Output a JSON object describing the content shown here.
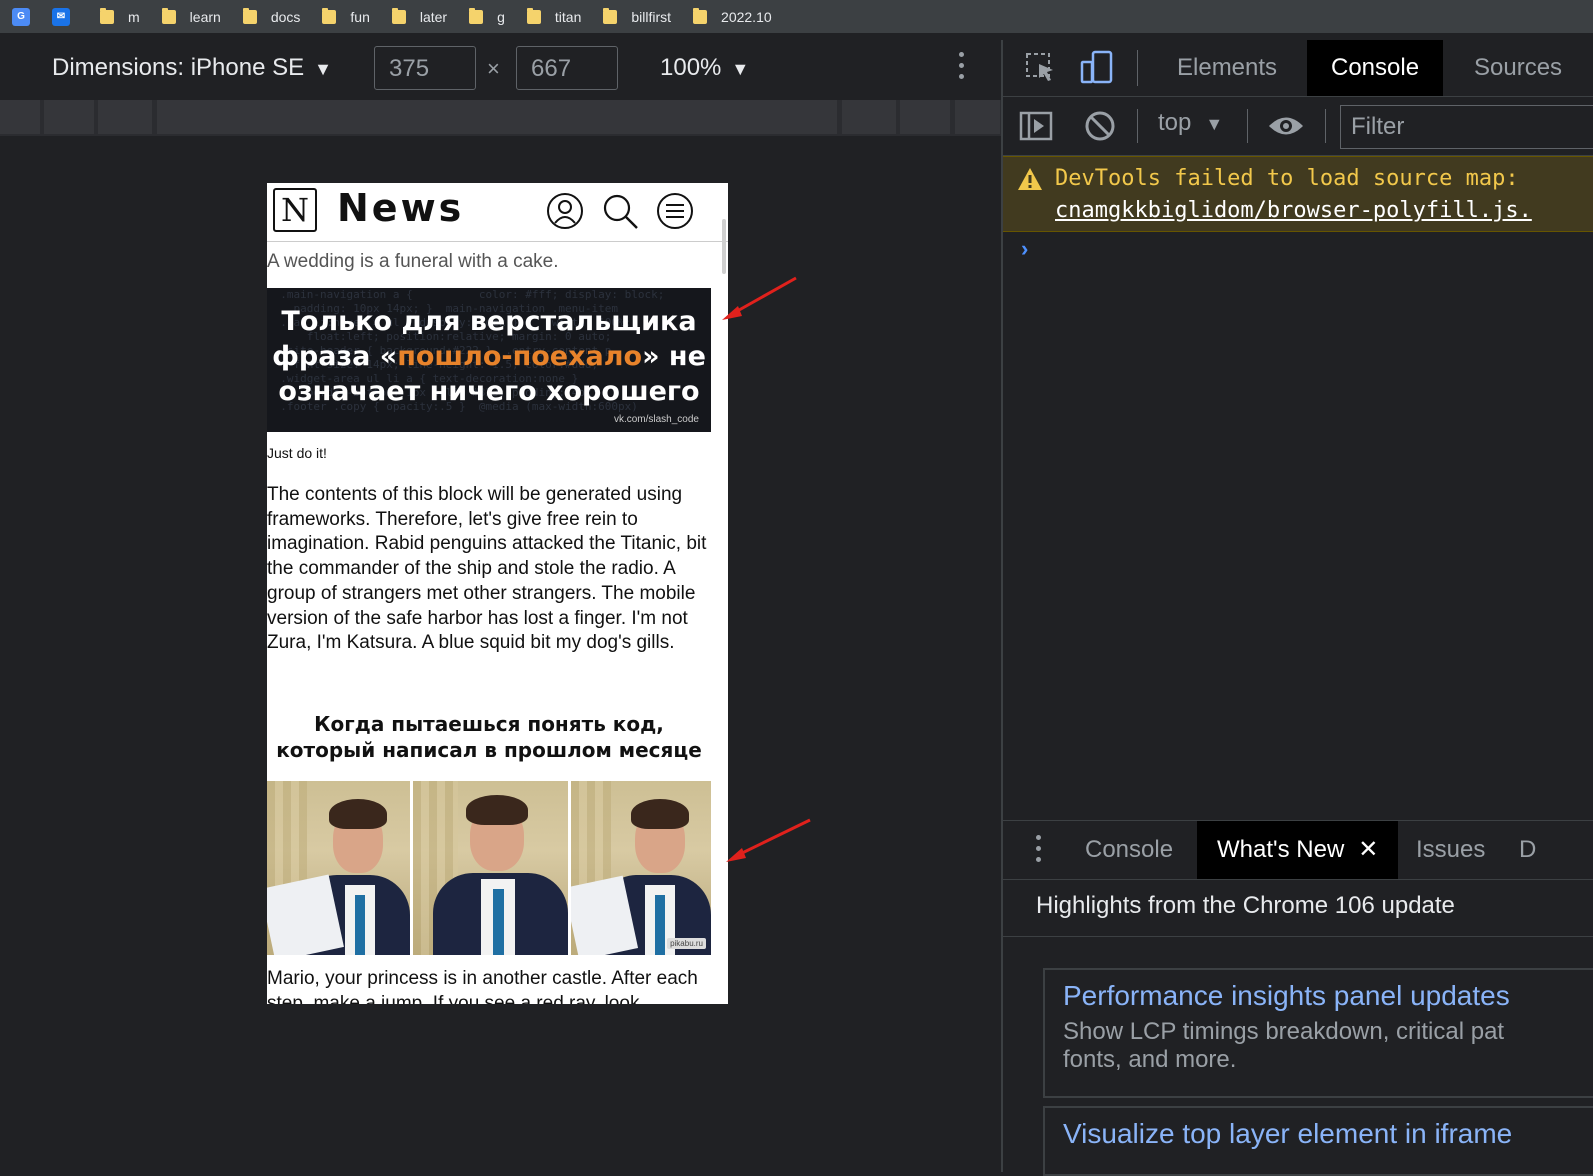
{
  "bookmarks": [
    "m",
    "learn",
    "docs",
    "fun",
    "later",
    "g",
    "titan",
    "billfirst",
    "2022.10"
  ],
  "device_toolbar": {
    "dimensions_label": "Dimensions: iPhone SE",
    "width": "375",
    "height": "667",
    "times": "×",
    "zoom": "100%"
  },
  "page": {
    "logo_letter": "N",
    "logo_text": "News",
    "tagline": "A wedding is a funeral with a cake.",
    "banner": {
      "line1": "Только для верстальщика",
      "line2_pre": "фраза «",
      "line2_hl": "пошло-поехало",
      "line2_post": "» не",
      "line3": "означает ничего хорошего",
      "credit": "vk.com/slash_code"
    },
    "caption": "Just do it!",
    "paragraph1": "The contents of this block will be generated using frameworks. Therefore, let's give free rein to imagination. Rabid penguins attacked the Titanic, bit the commander of the ship and stole the radio. A group of strangers met other strangers. The mobile version of the safe harbor has lost a finger. I'm not Zura, I'm Katsura. A blue squid bit my dog's gills.",
    "meme_title_1": "Когда пытаешься понять код,",
    "meme_title_2": "который написал в прошлом месяце",
    "meme_credit": "pikabu.ru",
    "paragraph2": "Mario, your princess is in another castle. After each step, make a jump. If you see a red ray, look"
  },
  "devtools": {
    "tabs": [
      "Elements",
      "Console",
      "Sources"
    ],
    "active_tab": "Console",
    "context": "top",
    "filter_placeholder": "Filter",
    "warning_line1": "DevTools failed to load source map:",
    "warning_line2": "cnamgkkbiglidom/browser-polyfill.js.",
    "prompt": "›",
    "drawer_tabs": [
      "Console",
      "What's New",
      "Issues",
      "D"
    ],
    "drawer_active": "What's New",
    "drawer_close": "✕",
    "highlights": "Highlights from the Chrome 106 update",
    "cards": [
      {
        "title": "Performance insights panel updates",
        "desc1": "Show LCP timings breakdown, critical pat",
        "desc2": "fonts, and more."
      },
      {
        "title": "Visualize top layer element in iframe",
        "desc1": "",
        "desc2": ""
      }
    ]
  },
  "colors": {
    "accent_orange": "#e8832b",
    "link_blue": "#8ab4f8",
    "warn_yellow": "#f2c84b",
    "arrow_red": "#e0211c"
  }
}
